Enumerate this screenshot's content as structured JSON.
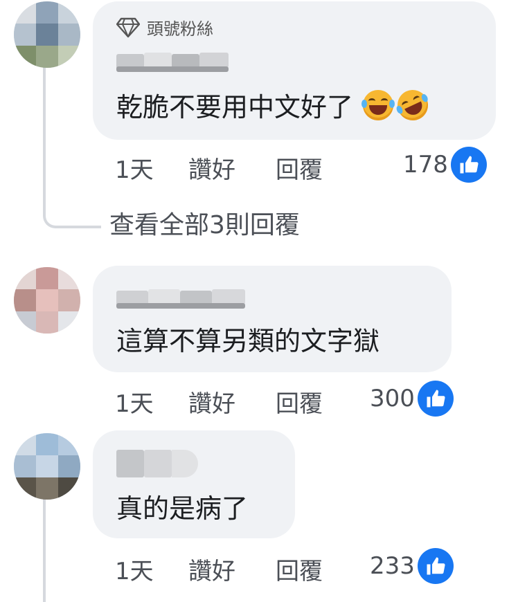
{
  "comments": [
    {
      "badge": "頭號粉絲",
      "text": "乾脆不要用中文好了",
      "emoji": [
        "laughing-tears-emoji",
        "rolling-laughing-emoji"
      ],
      "time": "1天",
      "like": "讚好",
      "reply": "回覆",
      "reaction_count": "178"
    },
    {
      "text": "這算不算另類的文字獄",
      "time": "1天",
      "like": "讚好",
      "reply": "回覆",
      "reaction_count": "300"
    },
    {
      "text": "真的是病了",
      "time": "1天",
      "like": "讚好",
      "reply": "回覆",
      "reaction_count": "233"
    }
  ],
  "view_replies": "查看全部3則回覆",
  "colors": {
    "bubble": "#f0f2f5",
    "like_blue": "#1877f2",
    "text": "#1c1e21",
    "meta": "#4b4f56"
  }
}
